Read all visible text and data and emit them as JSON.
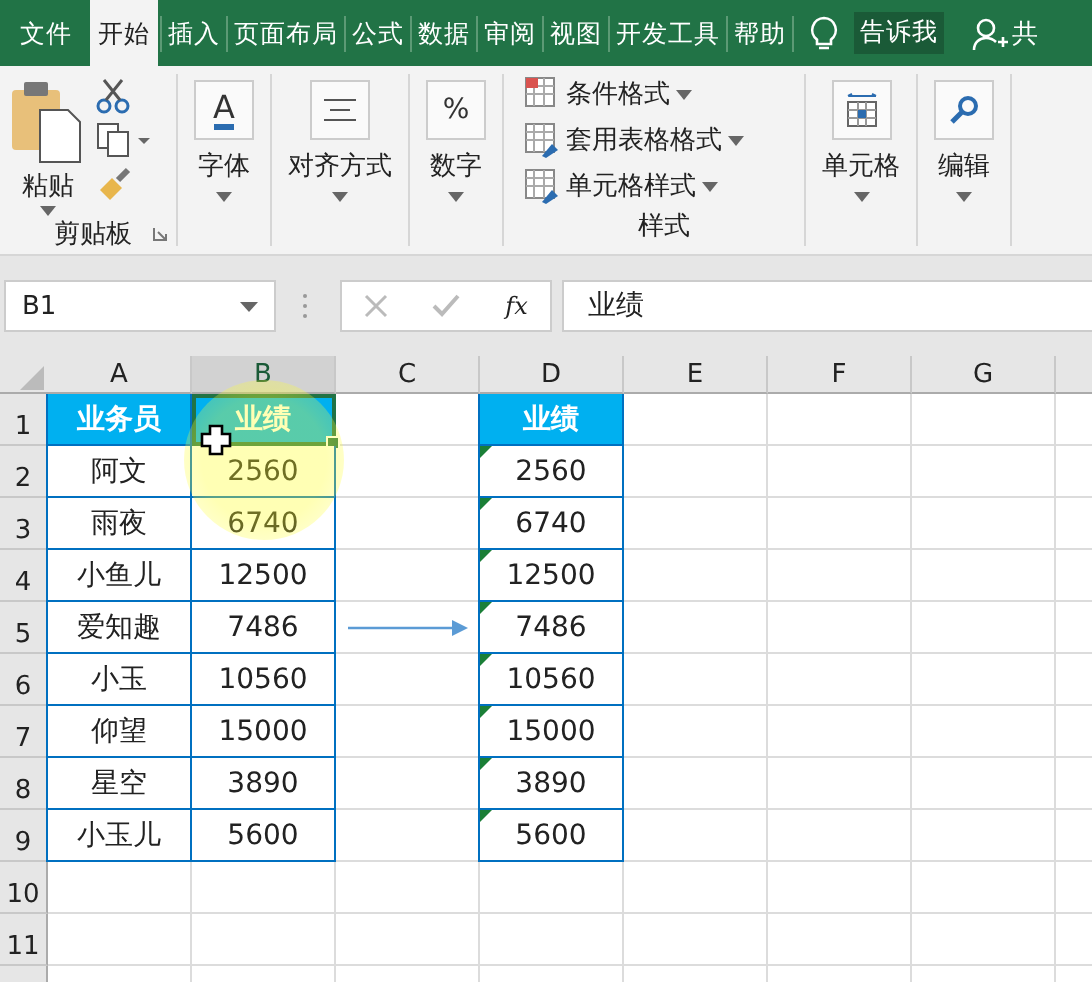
{
  "tabs": [
    {
      "label": "文件",
      "selected": false
    },
    {
      "label": "开始",
      "selected": true
    },
    {
      "label": "插入",
      "selected": false
    },
    {
      "label": "页面布局",
      "selected": false
    },
    {
      "label": "公式",
      "selected": false
    },
    {
      "label": "数据",
      "selected": false
    },
    {
      "label": "审阅",
      "selected": false
    },
    {
      "label": "视图",
      "selected": false
    },
    {
      "label": "开发工具",
      "selected": false
    },
    {
      "label": "帮助",
      "selected": false
    }
  ],
  "tell_me": "告诉我",
  "share": "共",
  "ribbon": {
    "groups": [
      {
        "kind": "clipboard",
        "label": "剪贴板",
        "button": "粘贴"
      },
      {
        "kind": "font",
        "button": "字体",
        "glyph": "A"
      },
      {
        "kind": "align",
        "button": "对齐方式"
      },
      {
        "kind": "number",
        "button": "数字",
        "glyph": "%"
      },
      {
        "kind": "styles",
        "label": "样式",
        "items": [
          "条件格式",
          "套用表格格式",
          "单元格样式"
        ]
      },
      {
        "kind": "cells",
        "button": "单元格"
      },
      {
        "kind": "editing",
        "button": "编辑"
      }
    ]
  },
  "formula_bar": {
    "name_box": "B1",
    "function_label": "fx",
    "value": "业绩"
  },
  "columns": [
    {
      "label": "A",
      "selected": false
    },
    {
      "label": "B",
      "selected": true
    },
    {
      "label": "C",
      "selected": false
    },
    {
      "label": "D",
      "selected": false
    },
    {
      "label": "E",
      "selected": false
    },
    {
      "label": "F",
      "selected": false
    },
    {
      "label": "G",
      "selected": false
    }
  ],
  "row_numbers": [
    "1",
    "2",
    "3",
    "4",
    "5",
    "6",
    "7",
    "8",
    "9",
    "10",
    "11"
  ],
  "table_left": {
    "header": [
      {
        "text": "业务员",
        "selected": false
      },
      {
        "text": "业绩",
        "selected": true
      }
    ],
    "rows": [
      [
        "阿文",
        "2560"
      ],
      [
        "雨夜",
        "6740"
      ],
      [
        "小鱼儿",
        "12500"
      ],
      [
        "爱知趣",
        "7486"
      ],
      [
        "小玉",
        "10560"
      ],
      [
        "仰望",
        "15000"
      ],
      [
        "星空",
        "3890"
      ],
      [
        "小玉儿",
        "5600"
      ]
    ]
  },
  "table_right": {
    "header": "业绩",
    "values": [
      {
        "text": "2560",
        "flagged": true
      },
      {
        "text": "6740",
        "flagged": true
      },
      {
        "text": "12500",
        "flagged": true
      },
      {
        "text": "7486",
        "flagged": true
      },
      {
        "text": "10560",
        "flagged": true
      },
      {
        "text": "15000",
        "flagged": true
      },
      {
        "text": "3890",
        "flagged": true
      },
      {
        "text": "5600",
        "flagged": true
      }
    ]
  }
}
